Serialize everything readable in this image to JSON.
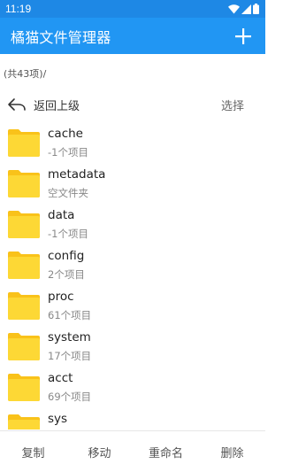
{
  "status_bar": {
    "time": "11:19",
    "icons": [
      "wifi-icon",
      "cell-signal-icon",
      "battery-icon"
    ]
  },
  "app_bar": {
    "title": "橘猫文件管理器",
    "add_icon": "plus-icon",
    "background": "#2196f3"
  },
  "summary": {
    "count_text": "(共43项)/"
  },
  "nav": {
    "back_label": "返回上级",
    "select_label": "选择"
  },
  "files": [
    {
      "name": "cache",
      "meta": "-1个项目"
    },
    {
      "name": "metadata",
      "meta": "空文件夹"
    },
    {
      "name": "data",
      "meta": "-1个项目"
    },
    {
      "name": "config",
      "meta": "2个项目"
    },
    {
      "name": "proc",
      "meta": "61个项目"
    },
    {
      "name": "system",
      "meta": "17个项目"
    },
    {
      "name": "acct",
      "meta": "69个项目"
    },
    {
      "name": "sys",
      "meta": ""
    }
  ],
  "actions": {
    "copy": "复制",
    "move": "移动",
    "rename": "重命名",
    "delete": "删除"
  },
  "colors": {
    "folder": "#fdd835",
    "folder_dark": "#f9c21a",
    "accent": "#2196f3"
  }
}
